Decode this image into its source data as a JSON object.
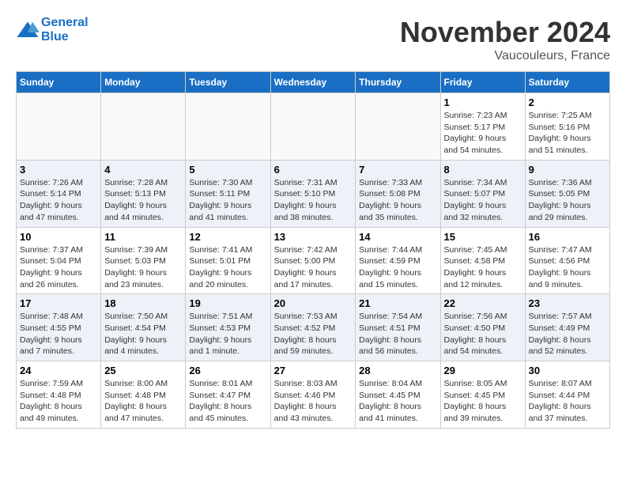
{
  "header": {
    "logo_line1": "General",
    "logo_line2": "Blue",
    "month": "November 2024",
    "location": "Vaucouleurs, France"
  },
  "weekdays": [
    "Sunday",
    "Monday",
    "Tuesday",
    "Wednesday",
    "Thursday",
    "Friday",
    "Saturday"
  ],
  "weeks": [
    [
      {
        "day": "",
        "info": ""
      },
      {
        "day": "",
        "info": ""
      },
      {
        "day": "",
        "info": ""
      },
      {
        "day": "",
        "info": ""
      },
      {
        "day": "",
        "info": ""
      },
      {
        "day": "1",
        "info": "Sunrise: 7:23 AM\nSunset: 5:17 PM\nDaylight: 9 hours\nand 54 minutes."
      },
      {
        "day": "2",
        "info": "Sunrise: 7:25 AM\nSunset: 5:16 PM\nDaylight: 9 hours\nand 51 minutes."
      }
    ],
    [
      {
        "day": "3",
        "info": "Sunrise: 7:26 AM\nSunset: 5:14 PM\nDaylight: 9 hours\nand 47 minutes."
      },
      {
        "day": "4",
        "info": "Sunrise: 7:28 AM\nSunset: 5:13 PM\nDaylight: 9 hours\nand 44 minutes."
      },
      {
        "day": "5",
        "info": "Sunrise: 7:30 AM\nSunset: 5:11 PM\nDaylight: 9 hours\nand 41 minutes."
      },
      {
        "day": "6",
        "info": "Sunrise: 7:31 AM\nSunset: 5:10 PM\nDaylight: 9 hours\nand 38 minutes."
      },
      {
        "day": "7",
        "info": "Sunrise: 7:33 AM\nSunset: 5:08 PM\nDaylight: 9 hours\nand 35 minutes."
      },
      {
        "day": "8",
        "info": "Sunrise: 7:34 AM\nSunset: 5:07 PM\nDaylight: 9 hours\nand 32 minutes."
      },
      {
        "day": "9",
        "info": "Sunrise: 7:36 AM\nSunset: 5:05 PM\nDaylight: 9 hours\nand 29 minutes."
      }
    ],
    [
      {
        "day": "10",
        "info": "Sunrise: 7:37 AM\nSunset: 5:04 PM\nDaylight: 9 hours\nand 26 minutes."
      },
      {
        "day": "11",
        "info": "Sunrise: 7:39 AM\nSunset: 5:03 PM\nDaylight: 9 hours\nand 23 minutes."
      },
      {
        "day": "12",
        "info": "Sunrise: 7:41 AM\nSunset: 5:01 PM\nDaylight: 9 hours\nand 20 minutes."
      },
      {
        "day": "13",
        "info": "Sunrise: 7:42 AM\nSunset: 5:00 PM\nDaylight: 9 hours\nand 17 minutes."
      },
      {
        "day": "14",
        "info": "Sunrise: 7:44 AM\nSunset: 4:59 PM\nDaylight: 9 hours\nand 15 minutes."
      },
      {
        "day": "15",
        "info": "Sunrise: 7:45 AM\nSunset: 4:58 PM\nDaylight: 9 hours\nand 12 minutes."
      },
      {
        "day": "16",
        "info": "Sunrise: 7:47 AM\nSunset: 4:56 PM\nDaylight: 9 hours\nand 9 minutes."
      }
    ],
    [
      {
        "day": "17",
        "info": "Sunrise: 7:48 AM\nSunset: 4:55 PM\nDaylight: 9 hours\nand 7 minutes."
      },
      {
        "day": "18",
        "info": "Sunrise: 7:50 AM\nSunset: 4:54 PM\nDaylight: 9 hours\nand 4 minutes."
      },
      {
        "day": "19",
        "info": "Sunrise: 7:51 AM\nSunset: 4:53 PM\nDaylight: 9 hours\nand 1 minute."
      },
      {
        "day": "20",
        "info": "Sunrise: 7:53 AM\nSunset: 4:52 PM\nDaylight: 8 hours\nand 59 minutes."
      },
      {
        "day": "21",
        "info": "Sunrise: 7:54 AM\nSunset: 4:51 PM\nDaylight: 8 hours\nand 56 minutes."
      },
      {
        "day": "22",
        "info": "Sunrise: 7:56 AM\nSunset: 4:50 PM\nDaylight: 8 hours\nand 54 minutes."
      },
      {
        "day": "23",
        "info": "Sunrise: 7:57 AM\nSunset: 4:49 PM\nDaylight: 8 hours\nand 52 minutes."
      }
    ],
    [
      {
        "day": "24",
        "info": "Sunrise: 7:59 AM\nSunset: 4:48 PM\nDaylight: 8 hours\nand 49 minutes."
      },
      {
        "day": "25",
        "info": "Sunrise: 8:00 AM\nSunset: 4:48 PM\nDaylight: 8 hours\nand 47 minutes."
      },
      {
        "day": "26",
        "info": "Sunrise: 8:01 AM\nSunset: 4:47 PM\nDaylight: 8 hours\nand 45 minutes."
      },
      {
        "day": "27",
        "info": "Sunrise: 8:03 AM\nSunset: 4:46 PM\nDaylight: 8 hours\nand 43 minutes."
      },
      {
        "day": "28",
        "info": "Sunrise: 8:04 AM\nSunset: 4:45 PM\nDaylight: 8 hours\nand 41 minutes."
      },
      {
        "day": "29",
        "info": "Sunrise: 8:05 AM\nSunset: 4:45 PM\nDaylight: 8 hours\nand 39 minutes."
      },
      {
        "day": "30",
        "info": "Sunrise: 8:07 AM\nSunset: 4:44 PM\nDaylight: 8 hours\nand 37 minutes."
      }
    ]
  ]
}
